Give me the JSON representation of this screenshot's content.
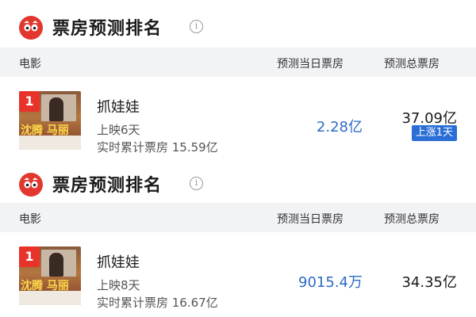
{
  "sections": [
    {
      "title": "票房预测排名",
      "info_icon": "info-icon",
      "header": {
        "movie": "电影",
        "day_box": "预测当日票房",
        "total_box": "预测总票房"
      },
      "row": {
        "rank": "1",
        "poster_text": "沈腾 马丽",
        "name": "抓娃娃",
        "days_label": "上映6天",
        "cumulative_label": "实时累计票房 15.59亿",
        "day_box": "2.28亿",
        "total_box": "37.09亿",
        "trend": "上涨1天"
      }
    },
    {
      "title": "票房预测排名",
      "info_icon": "info-icon",
      "header": {
        "movie": "电影",
        "day_box": "预测当日票房",
        "total_box": "预测总票房"
      },
      "row": {
        "rank": "1",
        "poster_text": "沈腾 马丽",
        "name": "抓娃娃",
        "days_label": "上映8天",
        "cumulative_label": "实时累计票房 16.67亿",
        "day_box": "9015.4万",
        "total_box": "34.35亿"
      }
    }
  ],
  "colors": {
    "brand_red": "#e2372e",
    "badge_red": "#e8332a",
    "value_blue": "#2d6bc4",
    "trend_blue": "#2b6fd6",
    "header_bg": "#f2f3f5"
  }
}
